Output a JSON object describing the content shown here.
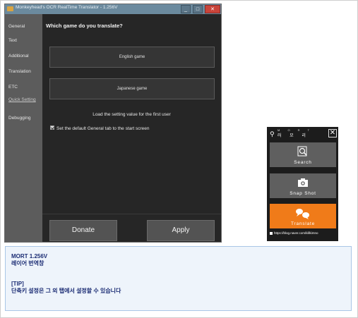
{
  "window": {
    "title": "Monkeyhead's OCR RealTime Translator - 1.256V",
    "minimize": "_",
    "maximize": "□",
    "close": "✕"
  },
  "sidebar": {
    "items": [
      {
        "label": "General"
      },
      {
        "label": "Text"
      },
      {
        "label": "Additional"
      },
      {
        "label": "Translation"
      },
      {
        "label": "ETC"
      },
      {
        "label": "Quick Setting"
      },
      {
        "label": "Debugging"
      }
    ]
  },
  "main": {
    "question": "Which game do you translate?",
    "english_button": "English game",
    "japanese_button": "Japanese game",
    "load_text": "Load the setting value for the first user",
    "checkbox_label": "Set the default General tab to the start screen",
    "checkbox_checked": true,
    "donate_button": "Donate",
    "apply_button": "Apply"
  },
  "widget": {
    "logo_small": "M O R T",
    "logo_big": "러 모 리",
    "close": "✕",
    "search_label": "Search",
    "snap_label": "Snap Shot",
    "translate_label": "Translate",
    "url": "https://blog.naver.com/killkimno",
    "translate_color": "#f07b19"
  },
  "info": {
    "line1": "MORT 1.256V",
    "line2": "레이어 번역창",
    "line3": "[TIP]",
    "line4": "단축키 설정은 그 외 탭에서 설정할 수 있습니다"
  }
}
